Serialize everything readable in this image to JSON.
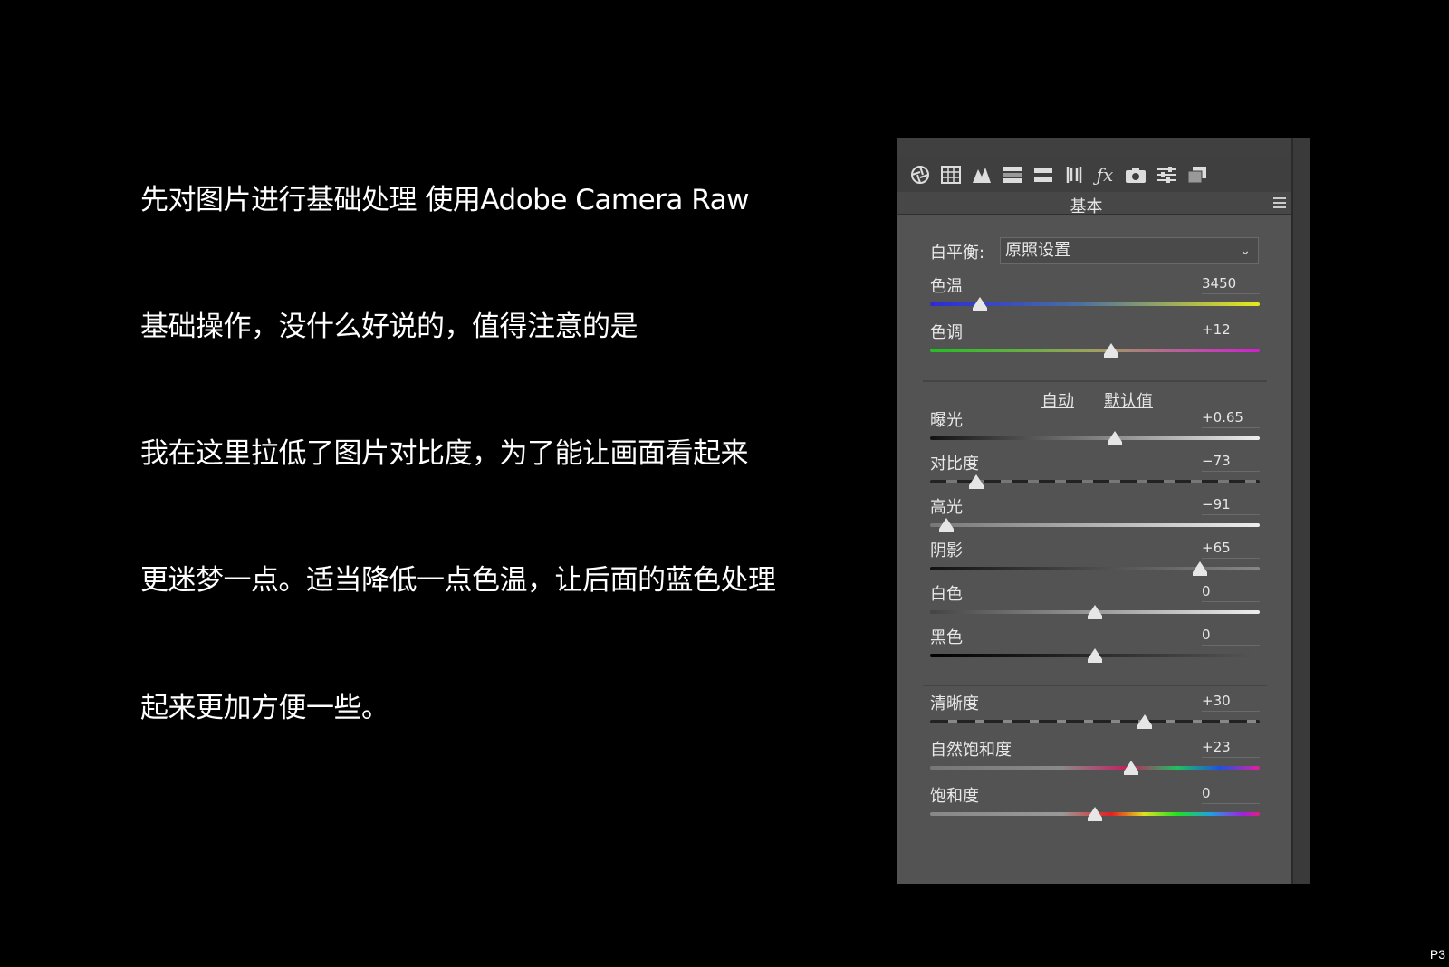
{
  "text_lines": [
    "先对图片进行基础处理 使用Adobe Camera Raw",
    "基础操作，没什么好说的，值得注意的是",
    "我在这里拉低了图片对比度，为了能让画面看起来",
    "更迷梦一点。适当降低一点色温，让后面的蓝色处理",
    "起来更加方便一些。"
  ],
  "page_number": "P3",
  "panel": {
    "section_title": "基本",
    "white_balance": {
      "label": "白平衡:",
      "value": "原照设置"
    },
    "auto_label": "自动",
    "default_label": "默认值",
    "sliders": [
      {
        "key": "temp",
        "label": "色温",
        "value": "3450",
        "position": 0.15
      },
      {
        "key": "tint",
        "label": "色调",
        "value": "+12",
        "position": 0.55
      },
      {
        "key": "exposure",
        "label": "曝光",
        "value": "+0.65",
        "position": 0.56
      },
      {
        "key": "contrast",
        "label": "对比度",
        "value": "−73",
        "position": 0.14
      },
      {
        "key": "highlights",
        "label": "高光",
        "value": "−91",
        "position": 0.05
      },
      {
        "key": "shadows",
        "label": "阴影",
        "value": "+65",
        "position": 0.82
      },
      {
        "key": "whites",
        "label": "白色",
        "value": "0",
        "position": 0.5
      },
      {
        "key": "blacks",
        "label": "黑色",
        "value": "0",
        "position": 0.5
      },
      {
        "key": "clarity",
        "label": "清晰度",
        "value": "+30",
        "position": 0.65
      },
      {
        "key": "vibrance",
        "label": "自然饱和度",
        "value": "+23",
        "position": 0.61
      },
      {
        "key": "saturation",
        "label": "饱和度",
        "value": "0",
        "position": 0.5
      }
    ],
    "colors": {
      "panel_bg": "#535353",
      "temp_gradient": [
        "#2b2bd6",
        "#e8e81a"
      ],
      "tint_gradient": [
        "#20c020",
        "#d020d0"
      ]
    },
    "tool_icons": [
      "aperture-icon",
      "histogram-grid-icon",
      "tone-curve-icon",
      "hsl-icon",
      "split-tone-icon",
      "lens-icon",
      "fx-icon",
      "camera-icon",
      "presets-icon",
      "snapshots-icon"
    ]
  }
}
